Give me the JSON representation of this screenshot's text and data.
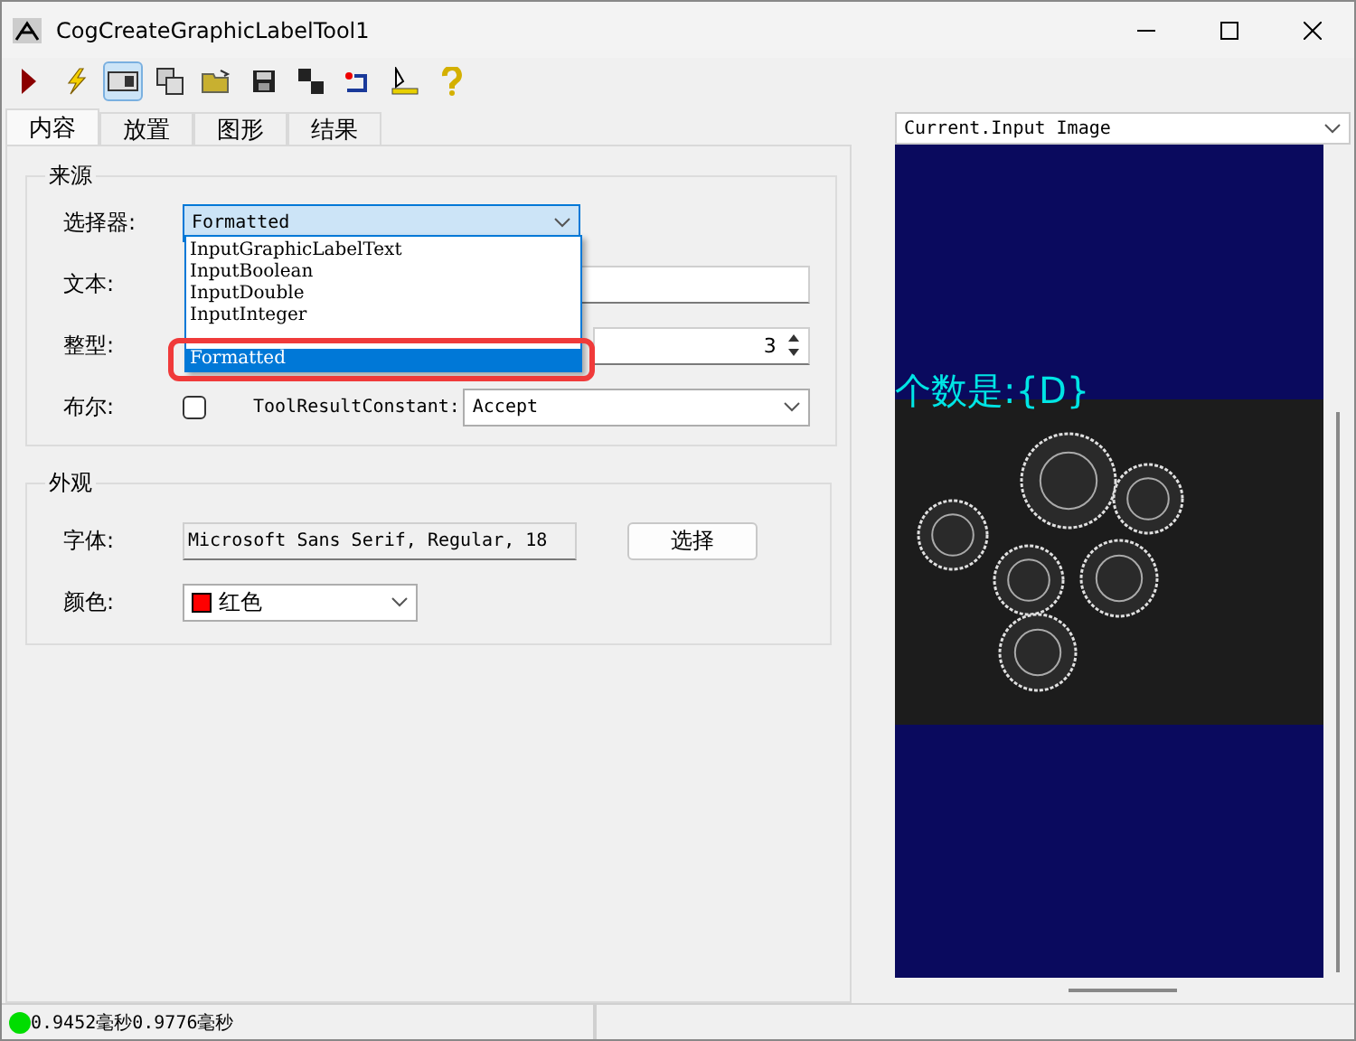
{
  "window": {
    "title": "CogCreateGraphicLabelTool1"
  },
  "toolbar": [
    {
      "kind": "run",
      "selected": false
    },
    {
      "kind": "bolt",
      "selected": false
    },
    {
      "kind": "panel",
      "selected": true
    },
    {
      "kind": "panels",
      "selected": false
    },
    {
      "kind": "open",
      "selected": false
    },
    {
      "kind": "save",
      "selected": false
    },
    {
      "kind": "saveas",
      "selected": false
    },
    {
      "kind": "reset",
      "selected": false
    },
    {
      "kind": "measure",
      "selected": false
    },
    {
      "kind": "help",
      "selected": false
    }
  ],
  "tabs": [
    {
      "label": "内容",
      "selected": true
    },
    {
      "label": "放置",
      "selected": false
    },
    {
      "label": "图形",
      "selected": false
    },
    {
      "label": "结果",
      "selected": false
    }
  ],
  "source": {
    "title": "来源",
    "selector": {
      "label": "选择器:",
      "value": "Formatted",
      "expanded": true,
      "options": [
        {
          "label": "InputGraphicLabelText",
          "selected": false
        },
        {
          "label": "InputBoolean",
          "selected": false
        },
        {
          "label": "InputDouble",
          "selected": false
        },
        {
          "label": "InputInteger",
          "selected": false
        },
        {
          "label": "Formatted",
          "selected": true
        }
      ]
    },
    "text": {
      "label": "文本:"
    },
    "integer": {
      "label": "整型:",
      "value": "3"
    },
    "boolean": {
      "label": "布尔:",
      "checked": false,
      "constant_label": "ToolResultConstant:",
      "constant_value": "Accept"
    }
  },
  "appearance": {
    "title": "外观",
    "font": {
      "label": "字体:",
      "value": "Microsoft Sans Serif, Regular, 18",
      "button": "选择"
    },
    "color": {
      "label": "颜色:",
      "value": "红色",
      "color": "#ff0000"
    }
  },
  "viewer": {
    "source": "Current.Input Image",
    "overlay_text": "个数是:{D}"
  },
  "status_bar": {
    "ok": true,
    "times": [
      "0.9452毫秒",
      "0.9776毫秒"
    ]
  }
}
